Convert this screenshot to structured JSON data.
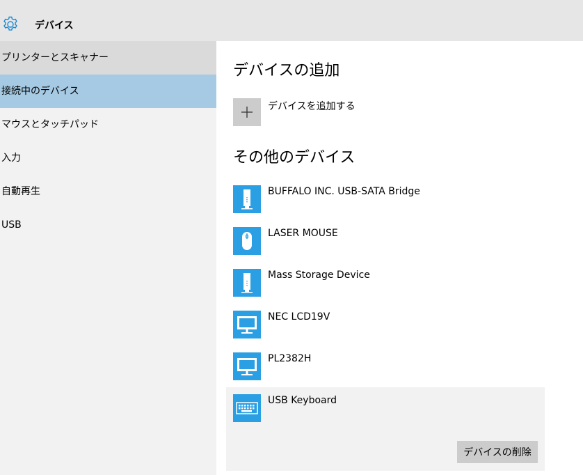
{
  "header": {
    "title": "デバイス",
    "icon": "gear-icon"
  },
  "sidebar": {
    "items": [
      {
        "label": "プリンターとスキャナー"
      },
      {
        "label": "接続中のデバイス"
      },
      {
        "label": "マウスとタッチパッド"
      },
      {
        "label": "入力"
      },
      {
        "label": "自動再生"
      },
      {
        "label": "USB"
      }
    ]
  },
  "main": {
    "add_section_title": "デバイスの追加",
    "add_button_label": "デバイスを追加する",
    "other_section_title": "その他のデバイス",
    "devices": [
      {
        "name": "BUFFALO INC. USB-SATA Bridge",
        "icon": "storage-device-icon"
      },
      {
        "name": "LASER MOUSE",
        "icon": "mouse-icon"
      },
      {
        "name": "Mass Storage Device",
        "icon": "storage-device-icon"
      },
      {
        "name": "NEC LCD19V",
        "icon": "monitor-icon"
      },
      {
        "name": "PL2382H",
        "icon": "monitor-icon"
      },
      {
        "name": "USB Keyboard",
        "icon": "keyboard-icon"
      }
    ],
    "remove_button_label": "デバイスの削除"
  },
  "colors": {
    "accent": "#2a9fe3",
    "selected_nav": "#a6cae3",
    "header_bg": "#e6e6e6"
  }
}
